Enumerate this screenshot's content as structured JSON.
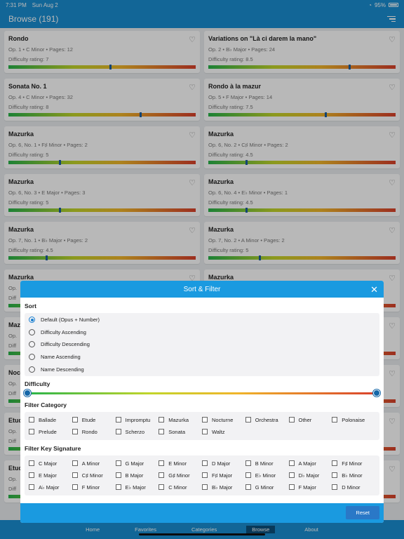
{
  "status": {
    "time": "7:31 PM",
    "date": "Sun Aug 2",
    "battery": "95%"
  },
  "header": {
    "title": "Browse (191)"
  },
  "cards": [
    {
      "title": "Rondo",
      "meta": "Op. 1 • C Minor • Pages: 12",
      "rating": "Difficulty rating: 7",
      "fraction": 0.54
    },
    {
      "title": "Variations on \"Là ci darem la mano\"",
      "meta": "Op. 2 • B♭ Major • Pages: 24",
      "rating": "Difficulty rating: 8.5",
      "fraction": 0.75
    },
    {
      "title": "Sonata No. 1",
      "meta": "Op. 4 • C Minor • Pages: 32",
      "rating": "Difficulty rating: 8",
      "fraction": 0.7
    },
    {
      "title": "Rondo à la mazur",
      "meta": "Op. 5 • F Major • Pages: 14",
      "rating": "Difficulty rating: 7.5",
      "fraction": 0.62
    },
    {
      "title": "Mazurka",
      "meta": "Op. 6, No. 1 • F♯ Minor • Pages: 2",
      "rating": "Difficulty rating: 5",
      "fraction": 0.27
    },
    {
      "title": "Mazurka",
      "meta": "Op. 6, No. 2 • C♯ Minor • Pages: 2",
      "rating": "Difficulty rating: 4.5",
      "fraction": 0.2
    },
    {
      "title": "Mazurka",
      "meta": "Op. 6, No. 3 • E Major • Pages: 3",
      "rating": "Difficulty rating: 5",
      "fraction": 0.27
    },
    {
      "title": "Mazurka",
      "meta": "Op. 6, No. 4 • E♭ Minor • Pages: 1",
      "rating": "Difficulty rating: 4.5",
      "fraction": 0.2
    },
    {
      "title": "Mazurka",
      "meta": "Op. 7, No. 1 • B♭ Major • Pages: 2",
      "rating": "Difficulty rating: 4.5",
      "fraction": 0.2
    },
    {
      "title": "Mazurka",
      "meta": "Op. 7, No. 2 • A Minor • Pages: 2",
      "rating": "Difficulty rating: 5",
      "fraction": 0.27
    },
    {
      "title": "Mazurka",
      "meta": "Op.",
      "rating": "Diff",
      "fraction": 0.3
    },
    {
      "title": "Mazurka",
      "meta": "Op.",
      "rating": "Diff",
      "fraction": 0.3
    },
    {
      "title": "Maz",
      "meta": "Op.",
      "rating": "Diff",
      "fraction": 0.3
    },
    {
      "title": "",
      "meta": "",
      "rating": "",
      "fraction": 0.3
    },
    {
      "title": "Noc",
      "meta": "Op.",
      "rating": "Diff",
      "fraction": 0.3
    },
    {
      "title": "",
      "meta": "",
      "rating": "",
      "fraction": 0.3
    },
    {
      "title": "Etud",
      "meta": "Op.",
      "rating": "Diff",
      "fraction": 0.3
    },
    {
      "title": "",
      "meta": "",
      "rating": "",
      "fraction": 0.3
    },
    {
      "title": "Etud",
      "meta": "Op.",
      "rating": "Diff",
      "fraction": 0.3
    },
    {
      "title": "",
      "meta": "",
      "rating": "",
      "fraction": 0.3
    }
  ],
  "tabs": [
    "Home",
    "Favorites",
    "Categories",
    "Browse",
    "About"
  ],
  "active_tab": 3,
  "modal": {
    "title": "Sort & Filter",
    "sort_label": "Sort",
    "sort_options": [
      "Default (Opus + Number)",
      "Difficulty Ascending",
      "Difficulty Descending",
      "Name Ascending",
      "Name Descending"
    ],
    "sort_selected": 0,
    "difficulty_label": "Difficulty",
    "difficulty_range": [
      0,
      1
    ],
    "category_label": "Filter Category",
    "categories": [
      "Ballade",
      "Etude",
      "Impromptu",
      "Mazurka",
      "Nocturne",
      "Orchestra",
      "Other",
      "Polonaise",
      "Prelude",
      "Rondo",
      "Scherzo",
      "Sonata",
      "Waltz"
    ],
    "key_label": "Filter Key Signature",
    "keys": [
      "C Major",
      "A Minor",
      "G Major",
      "E Minor",
      "D Major",
      "B Minor",
      "A Major",
      "F♯ Minor",
      "E Major",
      "C♯ Minor",
      "B Major",
      "G♯ Minor",
      "F♯ Major",
      "E♭ Minor",
      "D♭ Major",
      "B♭ Minor",
      "A♭ Major",
      "F Minor",
      "E♭ Major",
      "C Minor",
      "B♭ Major",
      "G Minor",
      "F Major",
      "D Minor"
    ],
    "reset_label": "Reset"
  },
  "colors": {
    "accent": "#1a8ed1",
    "modal_header": "#1a9ae0",
    "marker": "#1b5fa1"
  }
}
